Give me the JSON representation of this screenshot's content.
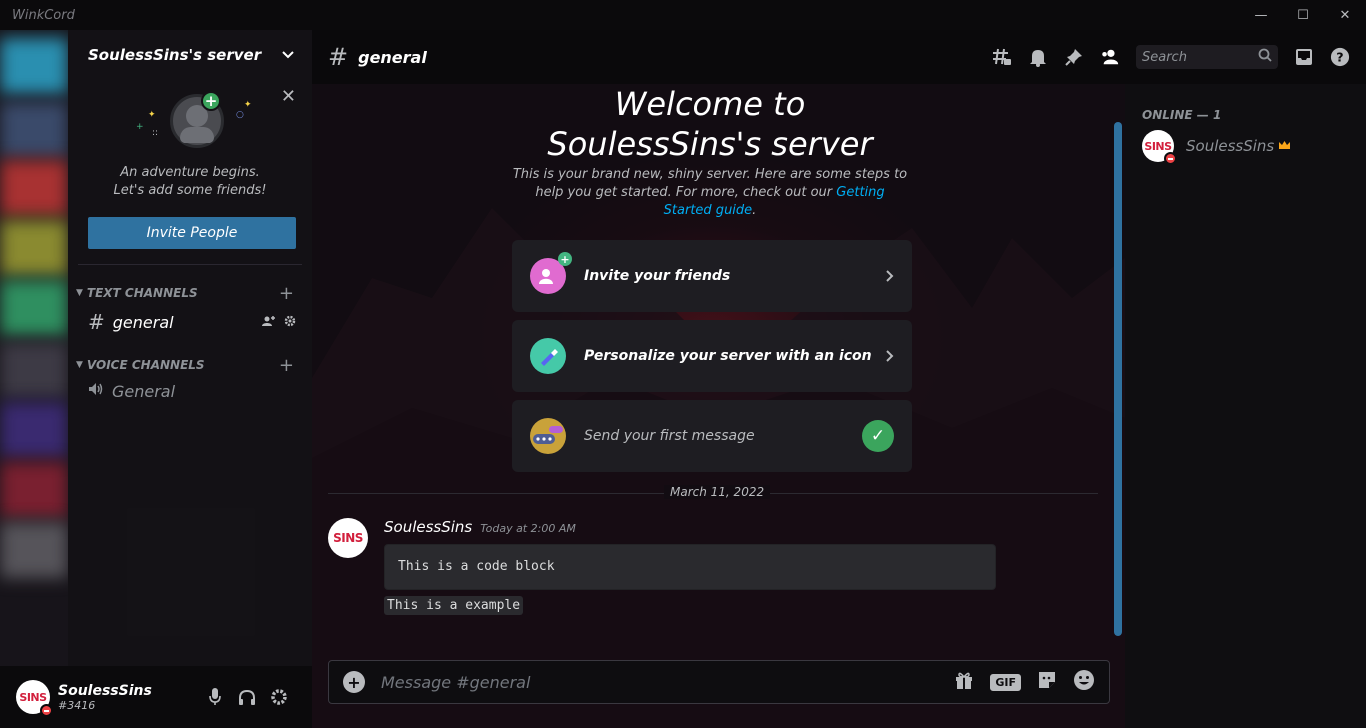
{
  "window": {
    "title": "WinkCord",
    "controls": [
      "—",
      "☐",
      "✕"
    ]
  },
  "server": {
    "name": "SoulessSins's server",
    "welcome_card": {
      "line1": "An adventure begins.",
      "line2": "Let's add some friends!",
      "invite_label": "Invite People"
    },
    "categories": [
      {
        "label": "TEXT CHANNELS",
        "channels": [
          {
            "name": "general"
          }
        ]
      },
      {
        "label": "VOICE CHANNELS",
        "channels": [
          {
            "name": "General"
          }
        ]
      }
    ]
  },
  "user": {
    "name": "SoulessSins",
    "tag": "#3416",
    "avatar_text": "SINS"
  },
  "header": {
    "channel": "general",
    "search_placeholder": "Search"
  },
  "welcome": {
    "title_line1": "Welcome to",
    "title_line2": "SoulessSins's server",
    "subtitle": "This is your brand new, shiny server. Here are some steps to help you get started. For more, check out our ",
    "link": "Getting Started guide",
    "subtitle_end": ".",
    "steps": [
      {
        "label": "Invite your friends",
        "done": false
      },
      {
        "label": "Personalize your server with an icon",
        "done": false
      },
      {
        "label": "Send your first message",
        "done": true
      }
    ]
  },
  "messages": {
    "date": "March 11, 2022",
    "author": "SoulessSins",
    "time": "Today at 2:00 AM",
    "code_block": "This is a code block",
    "inline_code": "This is a example"
  },
  "composer": {
    "placeholder": "Message #general",
    "gif_label": "GIF"
  },
  "members": {
    "header": "ONLINE — 1",
    "list": [
      {
        "name": "SoulessSins",
        "owner": true
      }
    ]
  },
  "colors": {
    "accent": "#2f72a0",
    "online_green": "#3ba55d",
    "dnd_red": "#ed4245",
    "link": "#00aff4"
  }
}
